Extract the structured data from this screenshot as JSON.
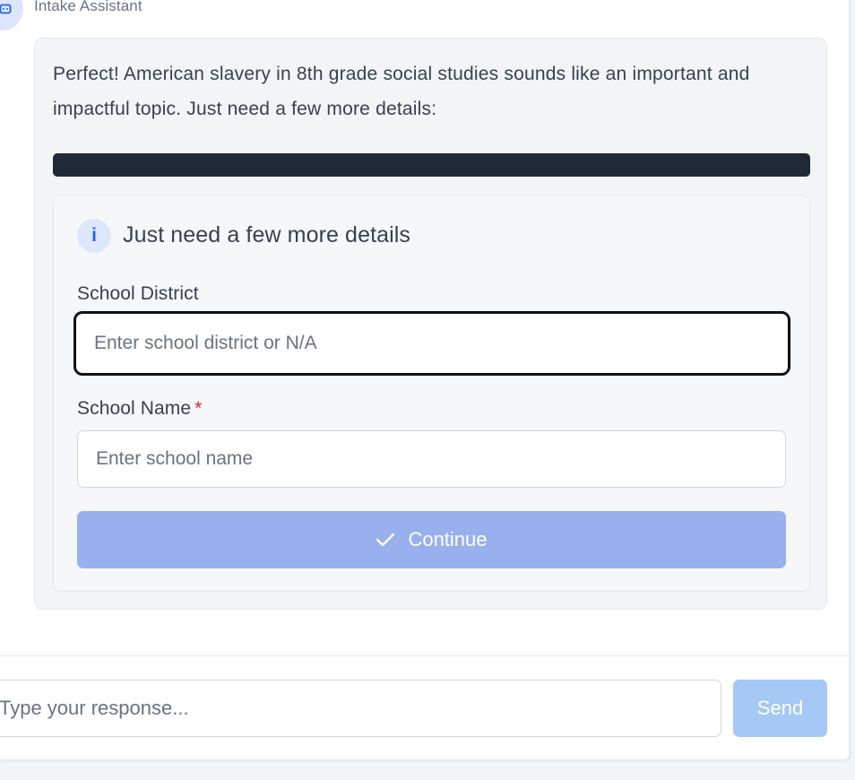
{
  "sender": {
    "name": "Intake Assistant"
  },
  "message": {
    "text": "Perfect! American slavery in 8th grade social studies sounds like an important and impactful topic. Just need a few more details:"
  },
  "form": {
    "title": "Just need a few more details",
    "info_icon_glyph": "i",
    "fields": [
      {
        "label": "School District",
        "required": false,
        "placeholder": "Enter school district or N/A",
        "value": ""
      },
      {
        "label": "School Name",
        "required": true,
        "required_mark": "*",
        "placeholder": "Enter school name",
        "value": ""
      }
    ],
    "continue_label": "Continue"
  },
  "composer": {
    "placeholder": "Type your response...",
    "send_label": "Send"
  },
  "colors": {
    "accent": "#2563eb",
    "continue_disabled": "#98b1ee",
    "send_disabled": "#a5c8f5",
    "required": "#dc2626"
  }
}
